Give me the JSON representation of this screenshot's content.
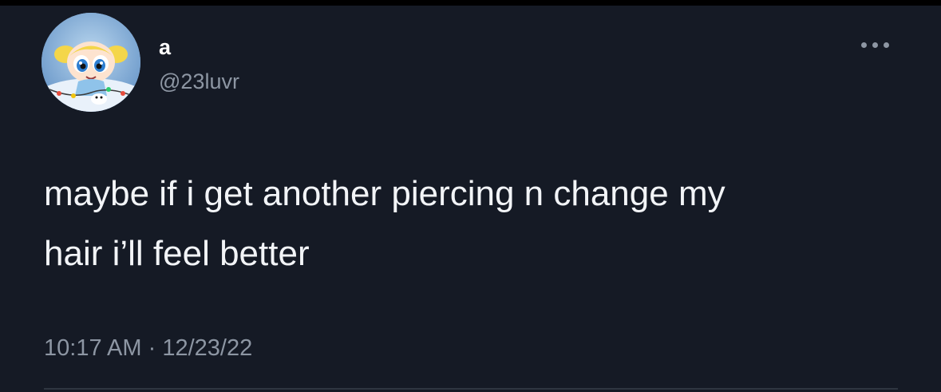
{
  "tweet": {
    "author": {
      "display_name": "a",
      "handle": "@23luvr",
      "avatar_icon": "bubbles-cartoon-avatar-icon"
    },
    "more_icon": "more-horizontal-icon",
    "text": "maybe if i get another piercing n change my\nhair i’ll feel better",
    "time": "10:17 AM",
    "separator": "·",
    "date": "12/23/22"
  },
  "colors": {
    "background": "#151a25",
    "text": "#f2f4f7",
    "secondary_text": "#8d96a3",
    "divider": "#2f3641"
  }
}
